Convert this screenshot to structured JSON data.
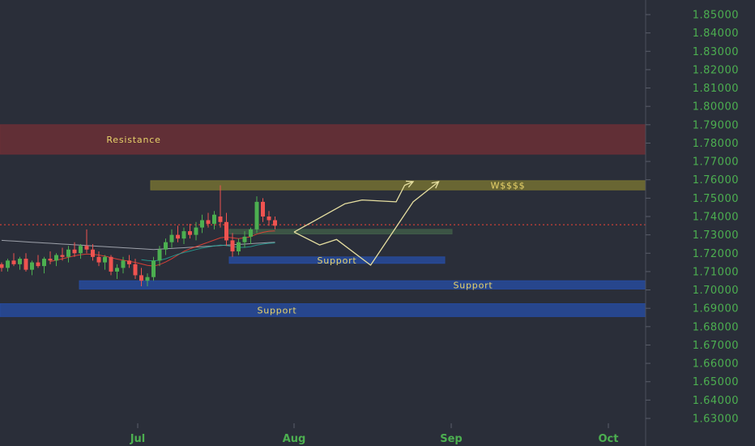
{
  "chart_data": {
    "type": "candlestick",
    "price_axis": {
      "ylim": [
        1.625,
        1.857
      ],
      "ticks": [
        "1.85000",
        "1.84000",
        "1.83000",
        "1.82000",
        "1.81000",
        "1.80000",
        "1.79000",
        "1.78000",
        "1.77000",
        "1.76000",
        "1.75000",
        "1.74000",
        "1.73000",
        "1.72000",
        "1.71000",
        "1.70000",
        "1.69000",
        "1.68000",
        "1.67000",
        "1.66000",
        "1.65000",
        "1.64000",
        "1.63000"
      ]
    },
    "time_axis": {
      "ticks": [
        "Jul",
        "Aug",
        "Sep",
        "Oct"
      ]
    },
    "last_price": 1.7355,
    "zones": [
      {
        "label": "Resistance",
        "low": 1.774,
        "high": 1.79,
        "color": "#6b2f36"
      },
      {
        "label": "W$$$$",
        "low": 1.7545,
        "high": 1.7595,
        "color": "#747032"
      },
      {
        "label": "",
        "low": 1.7305,
        "high": 1.733,
        "color": "#3f5a48"
      },
      {
        "label": "Support",
        "low": 1.7145,
        "high": 1.718,
        "color": "#274a9c"
      },
      {
        "label": "Support",
        "low": 1.7005,
        "high": 1.705,
        "color": "#274a9c"
      },
      {
        "label": "Support",
        "low": 1.6855,
        "high": 1.6925,
        "color": "#274a9c"
      }
    ],
    "candles": [
      [
        1.714,
        1.715,
        1.71,
        1.712
      ],
      [
        1.712,
        1.717,
        1.71,
        1.716
      ],
      [
        1.716,
        1.72,
        1.713,
        1.714
      ],
      [
        1.714,
        1.718,
        1.711,
        1.717
      ],
      [
        1.717,
        1.72,
        1.71,
        1.711
      ],
      [
        1.711,
        1.716,
        1.708,
        1.715
      ],
      [
        1.715,
        1.719,
        1.712,
        1.713
      ],
      [
        1.713,
        1.718,
        1.709,
        1.717
      ],
      [
        1.717,
        1.721,
        1.714,
        1.716
      ],
      [
        1.716,
        1.72,
        1.713,
        1.719
      ],
      [
        1.719,
        1.723,
        1.716,
        1.718
      ],
      [
        1.718,
        1.724,
        1.715,
        1.722
      ],
      [
        1.722,
        1.726,
        1.718,
        1.72
      ],
      [
        1.72,
        1.725,
        1.717,
        1.724
      ],
      [
        1.724,
        1.733,
        1.72,
        1.722
      ],
      [
        1.722,
        1.725,
        1.716,
        1.718
      ],
      [
        1.718,
        1.721,
        1.713,
        1.715
      ],
      [
        1.715,
        1.719,
        1.711,
        1.718
      ],
      [
        1.718,
        1.719,
        1.708,
        1.71
      ],
      [
        1.71,
        1.714,
        1.706,
        1.712
      ],
      [
        1.712,
        1.718,
        1.709,
        1.716
      ],
      [
        1.716,
        1.719,
        1.712,
        1.714
      ],
      [
        1.714,
        1.717,
        1.706,
        1.708
      ],
      [
        1.708,
        1.712,
        1.702,
        1.705
      ],
      [
        1.705,
        1.709,
        1.702,
        1.707
      ],
      [
        1.707,
        1.718,
        1.705,
        1.716
      ],
      [
        1.716,
        1.724,
        1.713,
        1.722
      ],
      [
        1.722,
        1.728,
        1.719,
        1.726
      ],
      [
        1.726,
        1.733,
        1.723,
        1.73
      ],
      [
        1.73,
        1.735,
        1.726,
        1.728
      ],
      [
        1.728,
        1.734,
        1.725,
        1.732
      ],
      [
        1.732,
        1.736,
        1.728,
        1.73
      ],
      [
        1.73,
        1.737,
        1.727,
        1.734
      ],
      [
        1.734,
        1.741,
        1.731,
        1.738
      ],
      [
        1.738,
        1.742,
        1.734,
        1.736
      ],
      [
        1.736,
        1.743,
        1.733,
        1.741
      ],
      [
        1.74,
        1.757,
        1.734,
        1.737
      ],
      [
        1.737,
        1.742,
        1.724,
        1.727
      ],
      [
        1.727,
        1.731,
        1.718,
        1.721
      ],
      [
        1.721,
        1.728,
        1.719,
        1.726
      ],
      [
        1.726,
        1.732,
        1.723,
        1.729
      ],
      [
        1.729,
        1.734,
        1.725,
        1.733
      ],
      [
        1.733,
        1.751,
        1.731,
        1.748
      ],
      [
        1.748,
        1.75,
        1.737,
        1.74
      ],
      [
        1.74,
        1.743,
        1.735,
        1.738
      ],
      [
        1.738,
        1.74,
        1.733,
        1.735
      ]
    ],
    "moving_averages": [
      {
        "color": "#b2b5be",
        "values": [
          1.727,
          1.7268,
          1.7266,
          1.7264,
          1.7262,
          1.726,
          1.7258,
          1.7256,
          1.7254,
          1.7252,
          1.725,
          1.7248,
          1.7246,
          1.7244,
          1.7242,
          1.724,
          1.7238,
          1.7236,
          1.7234,
          1.7232,
          1.723,
          1.7228,
          1.7226,
          1.7224,
          1.7222,
          1.722,
          1.7222,
          1.7224,
          1.7226,
          1.7228,
          1.723,
          1.7232,
          1.7234,
          1.7236,
          1.7238,
          1.724,
          1.7242,
          1.7244,
          1.7246,
          1.7248,
          1.725,
          1.7252,
          1.7254,
          1.7256,
          1.7258,
          1.726
        ]
      },
      {
        "color": "#f44336",
        "values": [
          null,
          null,
          null,
          null,
          null,
          null,
          null,
          null,
          1.7155,
          1.7162,
          1.717,
          1.7178,
          1.7186,
          1.7192,
          1.7196,
          1.7194,
          1.719,
          1.7184,
          1.7176,
          1.7168,
          1.7162,
          1.7156,
          1.715,
          1.7142,
          1.7134,
          1.713,
          1.7138,
          1.7152,
          1.717,
          1.719,
          1.721,
          1.7224,
          1.7236,
          1.7248,
          1.726,
          1.7272,
          1.7284,
          1.7288,
          1.7284,
          1.728,
          1.7284,
          1.729,
          1.7304,
          1.7314,
          1.732,
          1.7322
        ]
      },
      {
        "color": "#26a69a",
        "values": [
          null,
          null,
          null,
          null,
          null,
          null,
          null,
          null,
          null,
          null,
          null,
          null,
          null,
          null,
          null,
          null,
          null,
          null,
          null,
          null,
          null,
          null,
          null,
          1.7165,
          1.716,
          1.7158,
          1.7162,
          1.717,
          1.7182,
          1.7194,
          1.7204,
          1.7212,
          1.722,
          1.7228,
          1.7234,
          1.724,
          1.7244,
          1.7242,
          1.7236,
          1.7232,
          1.7232,
          1.7236,
          1.7244,
          1.725,
          1.7254,
          1.7256
        ]
      }
    ],
    "projection_path": [
      [
        0,
        1.7315
      ],
      [
        6,
        1.747
      ],
      [
        8,
        1.749
      ],
      [
        12,
        1.748
      ],
      [
        13,
        1.757
      ],
      [
        14,
        1.759
      ]
    ],
    "projection_path2": [
      [
        0,
        1.7315
      ],
      [
        3,
        1.7245
      ],
      [
        5,
        1.7275
      ],
      [
        9,
        1.7135
      ],
      [
        14,
        1.748
      ],
      [
        17,
        1.759
      ]
    ]
  }
}
